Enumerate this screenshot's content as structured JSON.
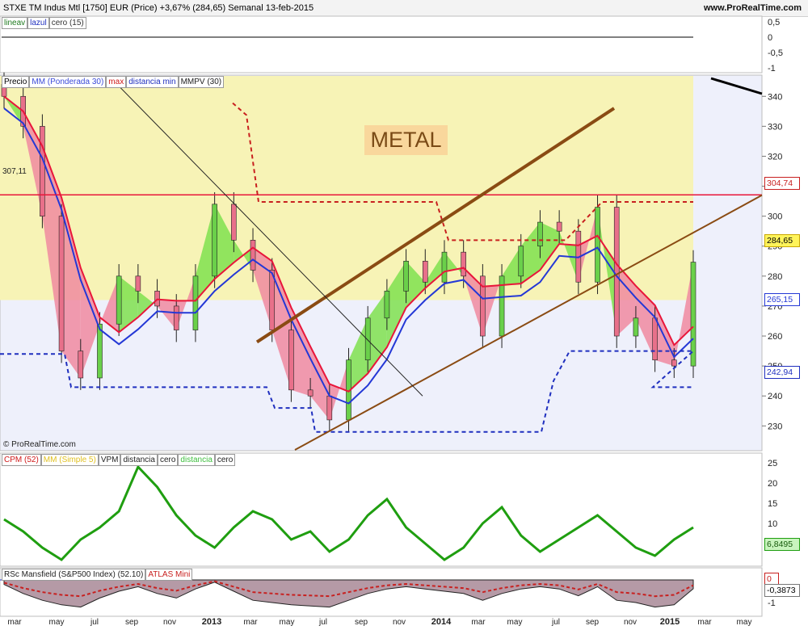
{
  "header": {
    "title": "STXE TM Indus Mtl [1750] EUR (Price)   +3,67% (284,65)   Semanal   13-feb-2015",
    "site": "www.ProRealTime.com"
  },
  "panels": {
    "top_legend": [
      "lineav",
      "lazul",
      "cero (15)"
    ],
    "main_legend": [
      "Precio",
      "MM (Ponderada 30)",
      "max",
      "distancia min",
      "MMPV (30)"
    ],
    "cpm_legend": [
      "CPM (52)",
      "MM (Simple 5)",
      "VPM",
      "distancia",
      "cero",
      "distancia",
      "cero"
    ],
    "rsc_legend": [
      "RSc Mansfield (S&P500 Index) (52.10)",
      "ATLAS Mini"
    ]
  },
  "annotations": {
    "metal": "METAL",
    "copyright": "© ProRealTime.com",
    "level_label": "307,11"
  },
  "badges": {
    "high": "304,74",
    "price": "284,65",
    "mm": "265,15",
    "low": "242,94",
    "cpm": "6,8495",
    "rsc_zero": "0",
    "rsc": "-0,3873"
  },
  "colors": {
    "up_fill": "#7fe04f",
    "down_fill": "#f08aa0",
    "wma": "#e8163a",
    "ema_blue": "#2438d6",
    "dashed_red": "#c8201f",
    "dashed_blue": "#1f2fbf",
    "channel": "#8a4b13",
    "yellow_zone": "#f7f3b6",
    "cpm_line": "#1f9e10"
  },
  "x_axis": [
    {
      "label": "mar",
      "year": false
    },
    {
      "label": "may",
      "year": false
    },
    {
      "label": "jul",
      "year": false
    },
    {
      "label": "sep",
      "year": false
    },
    {
      "label": "nov",
      "year": false
    },
    {
      "label": "2013",
      "year": true
    },
    {
      "label": "mar",
      "year": false
    },
    {
      "label": "may",
      "year": false
    },
    {
      "label": "jul",
      "year": false
    },
    {
      "label": "sep",
      "year": false
    },
    {
      "label": "nov",
      "year": false
    },
    {
      "label": "2014",
      "year": true
    },
    {
      "label": "mar",
      "year": false
    },
    {
      "label": "may",
      "year": false
    },
    {
      "label": "jul",
      "year": false
    },
    {
      "label": "sep",
      "year": false
    },
    {
      "label": "nov",
      "year": false
    },
    {
      "label": "2015",
      "year": true
    },
    {
      "label": "mar",
      "year": false
    },
    {
      "label": "may",
      "year": false
    }
  ],
  "chart_data": {
    "type": "line",
    "title": "STXE TM Indus Mtl [1750] EUR (Price)",
    "period": "Semanal",
    "x_range": [
      "feb 2012",
      "may 2015"
    ],
    "price_axis": {
      "ticks": [
        230,
        240,
        250,
        260,
        270,
        280,
        290,
        300,
        310,
        320,
        330,
        340
      ],
      "range": [
        222,
        346
      ]
    },
    "price_close_series": [
      {
        "x": "2012-02",
        "y": 340
      },
      {
        "x": "2012-03",
        "y": 330
      },
      {
        "x": "2012-04",
        "y": 300
      },
      {
        "x": "2012-05",
        "y": 255
      },
      {
        "x": "2012-06",
        "y": 246
      },
      {
        "x": "2012-07",
        "y": 264
      },
      {
        "x": "2012-08",
        "y": 280
      },
      {
        "x": "2012-09",
        "y": 275
      },
      {
        "x": "2012-10",
        "y": 270
      },
      {
        "x": "2012-11",
        "y": 262
      },
      {
        "x": "2012-12",
        "y": 280
      },
      {
        "x": "2013-01",
        "y": 304
      },
      {
        "x": "2013-02",
        "y": 292
      },
      {
        "x": "2013-03",
        "y": 282
      },
      {
        "x": "2013-04",
        "y": 262
      },
      {
        "x": "2013-05",
        "y": 242
      },
      {
        "x": "2013-06",
        "y": 240
      },
      {
        "x": "2013-07",
        "y": 232
      },
      {
        "x": "2013-08",
        "y": 252
      },
      {
        "x": "2013-09",
        "y": 266
      },
      {
        "x": "2013-10",
        "y": 275
      },
      {
        "x": "2013-11",
        "y": 285
      },
      {
        "x": "2013-12",
        "y": 278
      },
      {
        "x": "2014-01",
        "y": 288
      },
      {
        "x": "2014-02",
        "y": 280
      },
      {
        "x": "2014-03",
        "y": 260
      },
      {
        "x": "2014-04",
        "y": 280
      },
      {
        "x": "2014-05",
        "y": 290
      },
      {
        "x": "2014-06",
        "y": 298
      },
      {
        "x": "2014-07",
        "y": 295
      },
      {
        "x": "2014-08",
        "y": 278
      },
      {
        "x": "2014-09",
        "y": 303
      },
      {
        "x": "2014-10",
        "y": 260
      },
      {
        "x": "2014-11",
        "y": 266
      },
      {
        "x": "2014-12",
        "y": 252
      },
      {
        "x": "2015-01",
        "y": 250
      },
      {
        "x": "2015-02",
        "y": 284.65
      }
    ],
    "levels": {
      "max_line": 307.11,
      "last_price": 284.65,
      "mm_ponderada_30": 265.15,
      "dashed_high": 304.74,
      "dashed_low": 242.94
    },
    "cpm_axis": {
      "ticks": [
        5,
        10,
        15,
        20,
        25
      ],
      "last": 6.8495
    },
    "cpm_series": [
      11,
      8,
      4,
      1,
      6,
      9,
      13,
      24,
      19,
      12,
      7,
      4,
      9,
      13,
      11,
      6,
      8,
      3,
      6,
      12,
      16,
      9,
      5,
      1,
      4,
      10,
      14,
      7,
      3,
      6,
      9,
      12,
      8,
      4,
      2,
      6,
      9
    ],
    "rsc_axis": {
      "ticks": [
        0,
        -1
      ],
      "last": -0.3873
    },
    "top_axis": {
      "ticks": [
        0.5,
        0,
        -0.5,
        -1
      ]
    }
  }
}
